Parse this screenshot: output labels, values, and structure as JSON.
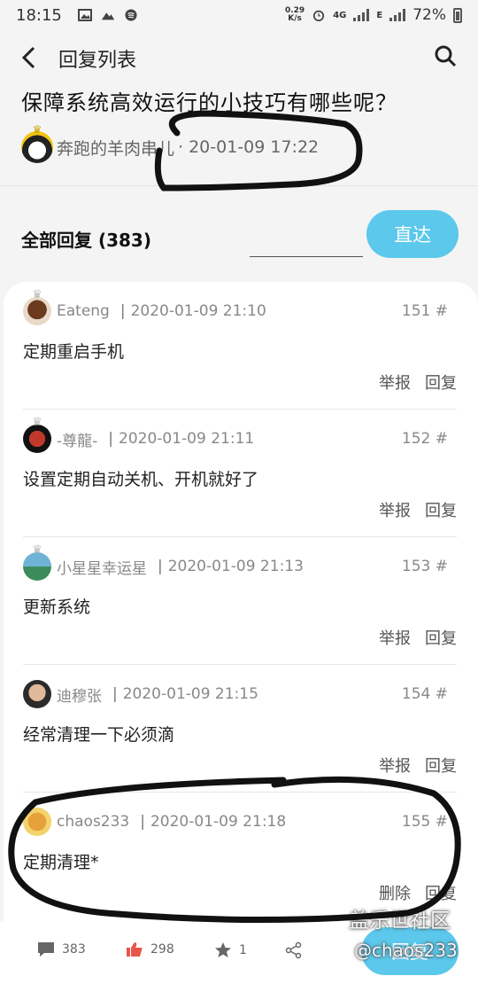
{
  "status_bar": {
    "time": "18:15",
    "net_speed_value": "0.29",
    "net_speed_unit": "K/s",
    "network": "4G",
    "signal2_label": "E",
    "battery": "72%"
  },
  "header": {
    "title": "回复列表"
  },
  "post": {
    "title": "保障系统高效运行的小技巧有哪些呢？",
    "author": "奔跑的羊肉串儿",
    "time": "· 20-01-09 17:22"
  },
  "replies_section": {
    "label": "全部回复 (383)",
    "go_label": "直达"
  },
  "replies": [
    {
      "user": "Eateng",
      "time": "2020-01-09 21:10",
      "floor": "151 #",
      "content": "定期重启手机",
      "action1": "举报",
      "action2": "回复"
    },
    {
      "user": "-尊龍-",
      "time": "2020-01-09 21:11",
      "floor": "152 #",
      "content": "设置定期自动关机、开机就好了",
      "action1": "举报",
      "action2": "回复"
    },
    {
      "user": "小星星幸运星",
      "time": "2020-01-09 21:13",
      "floor": "153 #",
      "content": " 更新系统",
      "action1": "举报",
      "action2": "回复"
    },
    {
      "user": "迪穆张",
      "time": "2020-01-09 21:15",
      "floor": "154 #",
      "content": "经常清理一下必须滴",
      "action1": "举报",
      "action2": "回复"
    },
    {
      "user": "chaos233",
      "time": "2020-01-09 21:18",
      "floor": "155 #",
      "content": "定期清理*",
      "action1": "删除",
      "action2": "回复"
    }
  ],
  "bottom_bar": {
    "comments": "383",
    "likes": "298",
    "favorites": "1",
    "reply_label": "回复"
  },
  "watermark": {
    "line1": "盖乐世社区",
    "line2": "@chaos233"
  },
  "colors": {
    "accent": "#5bc8ec"
  }
}
